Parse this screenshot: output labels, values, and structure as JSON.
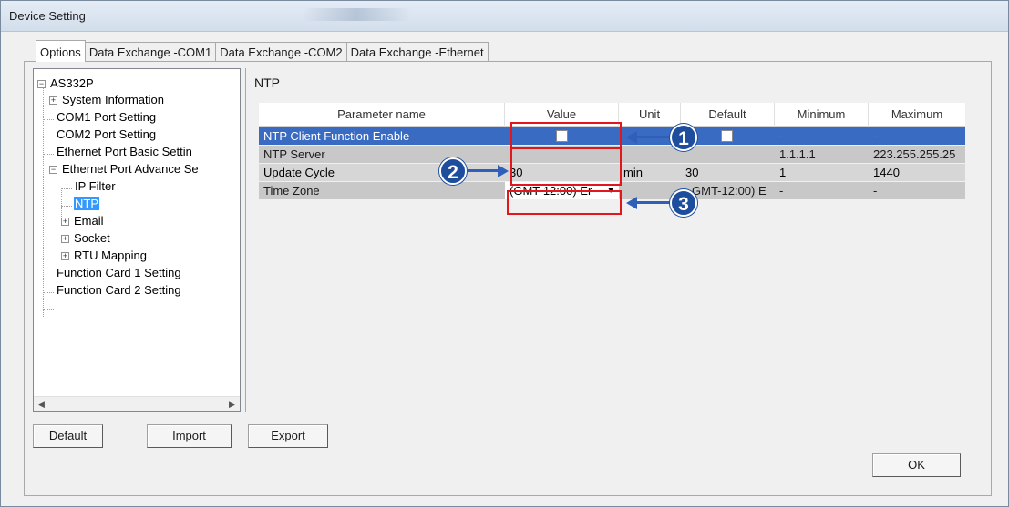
{
  "window": {
    "title": "Device Setting"
  },
  "tabs": [
    {
      "label": "Options",
      "active": true
    },
    {
      "label": "Data Exchange -COM1",
      "active": false
    },
    {
      "label": "Data Exchange -COM2",
      "active": false
    },
    {
      "label": "Data Exchange -Ethernet",
      "active": false
    }
  ],
  "tree": {
    "root": {
      "label": "AS332P",
      "expander": "⊟"
    },
    "items": [
      {
        "label": "System Information",
        "expander": "+"
      },
      {
        "label": "COM1 Port Setting"
      },
      {
        "label": "COM2 Port Setting"
      },
      {
        "label": "Ethernet Port Basic Settin"
      },
      {
        "label": "Ethernet Port Advance Se",
        "expander": "−"
      },
      {
        "label": "IP Filter"
      },
      {
        "label": "NTP",
        "selected": true
      },
      {
        "label": "Email",
        "expander": "+"
      },
      {
        "label": "Socket",
        "expander": "+"
      },
      {
        "label": "RTU Mapping",
        "expander": "+"
      },
      {
        "label": "Function Card 1 Setting"
      },
      {
        "label": "Function Card 2 Setting"
      }
    ],
    "scroll_left": "◀",
    "scroll_right": "▶"
  },
  "section_title": "NTP",
  "grid": {
    "headers": [
      "Parameter name",
      "Value",
      "Unit",
      "Default",
      "Minimum",
      "Maximum"
    ],
    "rows": [
      {
        "name": "NTP Client Function Enable",
        "value": "",
        "unit": "",
        "default": "",
        "minimum": "-",
        "maximum": "-"
      },
      {
        "name": "NTP Server",
        "value": "",
        "unit": "",
        "default": "",
        "minimum": "1.1.1.1",
        "maximum": "223.255.255.25"
      },
      {
        "name": "Update Cycle",
        "value": "30",
        "unit": "min",
        "default": "30",
        "minimum": "1",
        "maximum": "1440"
      },
      {
        "name": "Time Zone",
        "value": "(GMT-12:00) Er",
        "unit": "",
        "default": "GMT-12:00) E",
        "minimum": "-",
        "maximum": "-"
      }
    ],
    "dropdown_arrow": "▼"
  },
  "callouts": [
    "1",
    "2",
    "3"
  ],
  "buttons": {
    "default": "Default",
    "import": "Import",
    "export": "Export",
    "ok": "OK"
  },
  "colors": {
    "selection_row": "#3a6bc3",
    "highlight_box": "#e3161b",
    "callout": "#1f4d9e"
  }
}
